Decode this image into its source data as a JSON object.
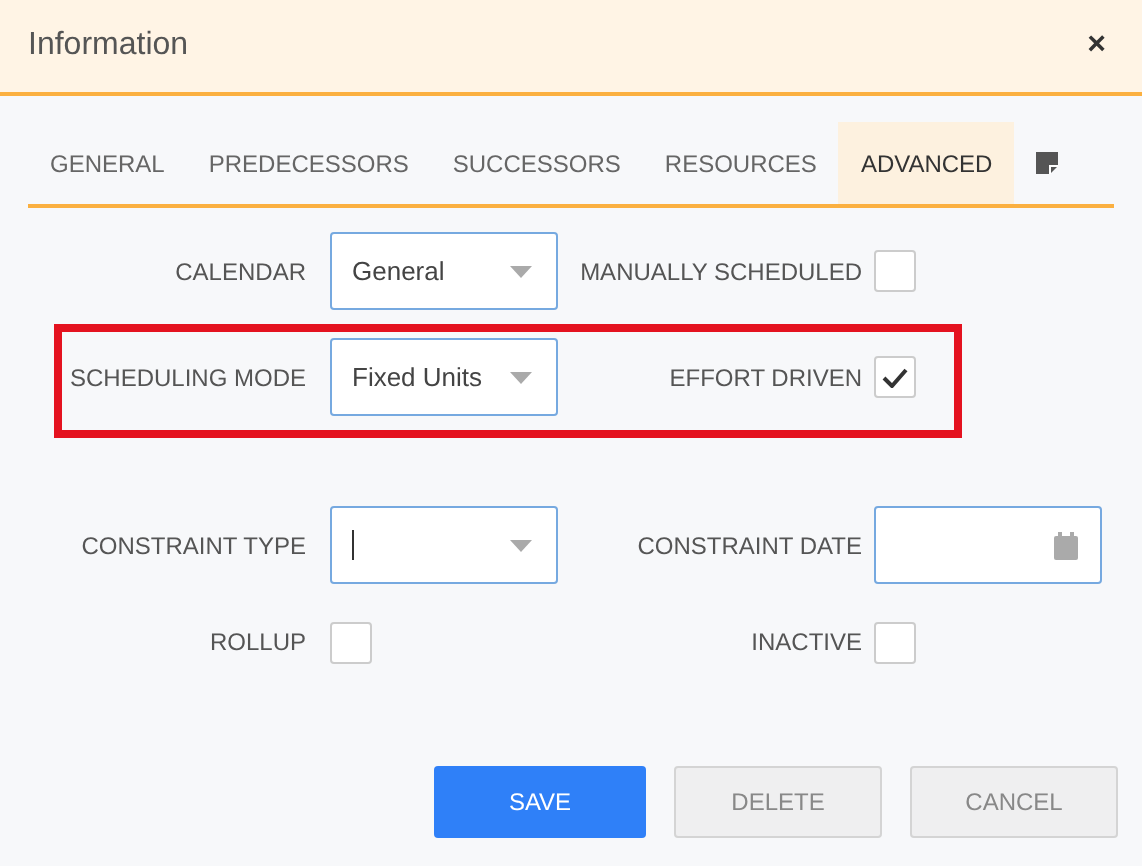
{
  "dialog": {
    "title": "Information",
    "close": "×"
  },
  "tabs": [
    {
      "label": "GENERAL",
      "selected": false,
      "kind": "text"
    },
    {
      "label": "PREDECESSORS",
      "selected": false,
      "kind": "text"
    },
    {
      "label": "SUCCESSORS",
      "selected": false,
      "kind": "text"
    },
    {
      "label": "RESOURCES",
      "selected": false,
      "kind": "text"
    },
    {
      "label": "ADVANCED",
      "selected": true,
      "kind": "text"
    },
    {
      "selected": false,
      "kind": "note-icon"
    }
  ],
  "rows": [
    {
      "fields": [
        {
          "label": "CALENDAR",
          "kind": "dropdown",
          "value": "General"
        },
        {
          "label": "MANUALLY SCHEDULED",
          "kind": "checkbox",
          "checked": false
        }
      ]
    },
    {
      "fields": [
        {
          "label": "SCHEDULING MODE",
          "kind": "dropdown",
          "value": "Fixed Units"
        },
        {
          "label": "EFFORT DRIVEN",
          "kind": "checkbox",
          "checked": true
        }
      ]
    },
    {
      "fields": [
        {
          "label": "CONSTRAINT TYPE",
          "kind": "dropdown",
          "focused": true
        },
        {
          "label": "CONSTRAINT DATE",
          "kind": "date"
        }
      ]
    },
    {
      "fields": [
        {
          "label": "ROLLUP",
          "kind": "checkbox",
          "checked": false
        },
        {
          "label": "INACTIVE",
          "kind": "checkbox",
          "checked": false
        }
      ]
    }
  ],
  "buttons": [
    {
      "label": "SAVE",
      "primary": true
    },
    {
      "label": "DELETE",
      "primary": false
    },
    {
      "label": "CANCEL",
      "primary": false
    }
  ]
}
